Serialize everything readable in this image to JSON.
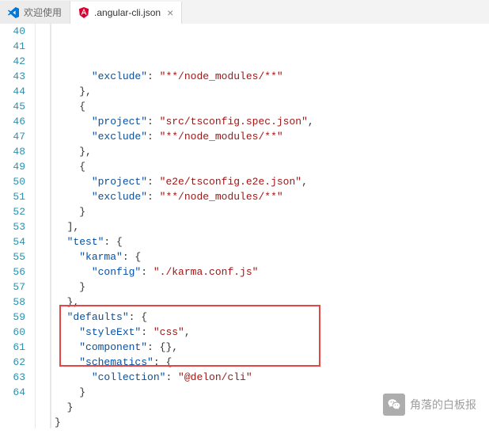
{
  "tabs": {
    "inactive_label": "欢迎使用",
    "active_label": ".angular-cli.json"
  },
  "lines": [
    {
      "n": 40,
      "tokens": [
        {
          "t": "      ",
          "c": "p"
        },
        {
          "t": "\"exclude\"",
          "c": "k"
        },
        {
          "t": ": ",
          "c": "p"
        },
        {
          "t": "\"**/node_modules/**\"",
          "c": "s"
        }
      ]
    },
    {
      "n": 41,
      "tokens": [
        {
          "t": "    },",
          "c": "p"
        }
      ]
    },
    {
      "n": 42,
      "tokens": [
        {
          "t": "    {",
          "c": "p"
        }
      ]
    },
    {
      "n": 43,
      "tokens": [
        {
          "t": "      ",
          "c": "p"
        },
        {
          "t": "\"project\"",
          "c": "k"
        },
        {
          "t": ": ",
          "c": "p"
        },
        {
          "t": "\"src/tsconfig.spec.json\"",
          "c": "s"
        },
        {
          "t": ",",
          "c": "p"
        }
      ]
    },
    {
      "n": 44,
      "tokens": [
        {
          "t": "      ",
          "c": "p"
        },
        {
          "t": "\"exclude\"",
          "c": "k"
        },
        {
          "t": ": ",
          "c": "p"
        },
        {
          "t": "\"**/node_modules/**\"",
          "c": "s"
        }
      ]
    },
    {
      "n": 45,
      "tokens": [
        {
          "t": "    },",
          "c": "p"
        }
      ]
    },
    {
      "n": 46,
      "tokens": [
        {
          "t": "    {",
          "c": "p"
        }
      ]
    },
    {
      "n": 47,
      "tokens": [
        {
          "t": "      ",
          "c": "p"
        },
        {
          "t": "\"project\"",
          "c": "k"
        },
        {
          "t": ": ",
          "c": "p"
        },
        {
          "t": "\"e2e/tsconfig.e2e.json\"",
          "c": "s"
        },
        {
          "t": ",",
          "c": "p"
        }
      ]
    },
    {
      "n": 48,
      "tokens": [
        {
          "t": "      ",
          "c": "p"
        },
        {
          "t": "\"exclude\"",
          "c": "k"
        },
        {
          "t": ": ",
          "c": "p"
        },
        {
          "t": "\"**/node_modules/**\"",
          "c": "s"
        }
      ]
    },
    {
      "n": 49,
      "tokens": [
        {
          "t": "    }",
          "c": "p"
        }
      ]
    },
    {
      "n": 50,
      "tokens": [
        {
          "t": "  ],",
          "c": "p"
        }
      ]
    },
    {
      "n": 51,
      "tokens": [
        {
          "t": "  ",
          "c": "p"
        },
        {
          "t": "\"test\"",
          "c": "k"
        },
        {
          "t": ": {",
          "c": "p"
        }
      ]
    },
    {
      "n": 52,
      "tokens": [
        {
          "t": "    ",
          "c": "p"
        },
        {
          "t": "\"karma\"",
          "c": "k"
        },
        {
          "t": ": {",
          "c": "p"
        }
      ]
    },
    {
      "n": 53,
      "tokens": [
        {
          "t": "      ",
          "c": "p"
        },
        {
          "t": "\"config\"",
          "c": "k"
        },
        {
          "t": ": ",
          "c": "p"
        },
        {
          "t": "\"./karma.conf.js\"",
          "c": "s"
        }
      ]
    },
    {
      "n": 54,
      "tokens": [
        {
          "t": "    }",
          "c": "p"
        }
      ]
    },
    {
      "n": 55,
      "tokens": [
        {
          "t": "  },",
          "c": "p"
        }
      ]
    },
    {
      "n": 56,
      "tokens": [
        {
          "t": "  ",
          "c": "p"
        },
        {
          "t": "\"defaults\"",
          "c": "k"
        },
        {
          "t": ": {",
          "c": "p"
        }
      ]
    },
    {
      "n": 57,
      "tokens": [
        {
          "t": "    ",
          "c": "p"
        },
        {
          "t": "\"styleExt\"",
          "c": "k"
        },
        {
          "t": ": ",
          "c": "p"
        },
        {
          "t": "\"css\"",
          "c": "s"
        },
        {
          "t": ",",
          "c": "p"
        }
      ]
    },
    {
      "n": 58,
      "tokens": [
        {
          "t": "    ",
          "c": "p"
        },
        {
          "t": "\"component\"",
          "c": "k"
        },
        {
          "t": ": {},",
          "c": "p"
        }
      ]
    },
    {
      "n": 59,
      "tokens": [
        {
          "t": "    ",
          "c": "p"
        },
        {
          "t": "\"schematics\"",
          "c": "k"
        },
        {
          "t": ": {",
          "c": "p"
        }
      ]
    },
    {
      "n": 60,
      "tokens": [
        {
          "t": "      ",
          "c": "p"
        },
        {
          "t": "\"collection\"",
          "c": "k"
        },
        {
          "t": ": ",
          "c": "p"
        },
        {
          "t": "\"@delon/cli\"",
          "c": "s"
        }
      ]
    },
    {
      "n": 61,
      "tokens": [
        {
          "t": "    }",
          "c": "p"
        }
      ]
    },
    {
      "n": 62,
      "tokens": [
        {
          "t": "  }",
          "c": "p"
        }
      ]
    },
    {
      "n": 63,
      "tokens": [
        {
          "t": "}",
          "c": "p"
        }
      ]
    },
    {
      "n": 64,
      "tokens": []
    }
  ],
  "watermark": {
    "text": "角落的白板报",
    "icon_label": "wechat"
  }
}
